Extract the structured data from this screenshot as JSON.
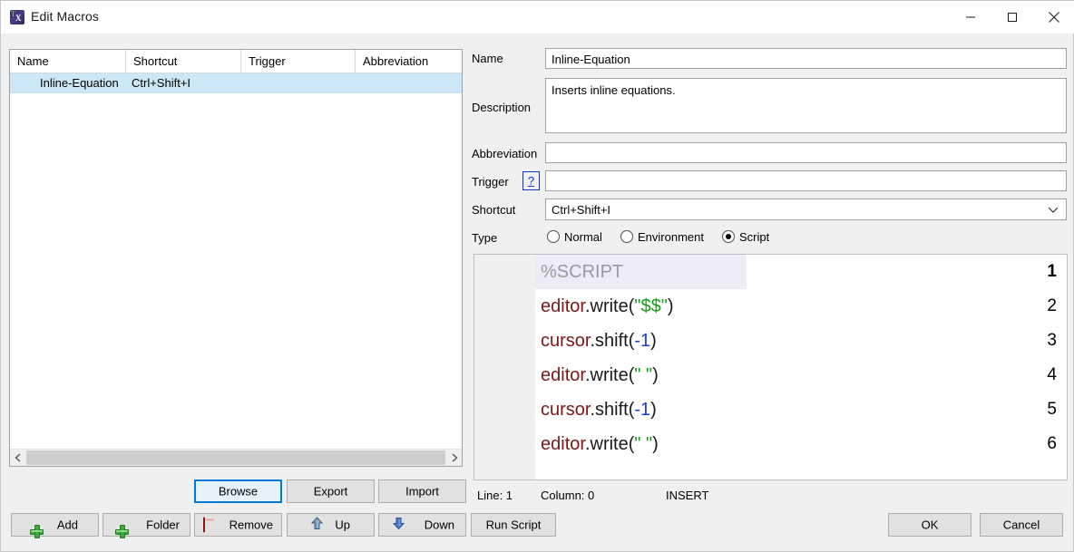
{
  "window": {
    "title": "Edit Macros",
    "icon": "texstudio-macro-icon",
    "controls": {
      "minimize": "minimize-icon",
      "maximize": "maximize-icon",
      "close": "close-icon"
    }
  },
  "macro_list": {
    "columns": [
      "Name",
      "Shortcut",
      "Trigger",
      "Abbreviation"
    ],
    "rows": [
      {
        "name": "Inline-Equation",
        "shortcut": "Ctrl+Shift+I",
        "trigger": "",
        "abbreviation": "",
        "selected": true
      }
    ],
    "scrollbar": {
      "left_arrow": "chevron-left-icon",
      "right_arrow": "chevron-right-icon"
    }
  },
  "form": {
    "name_label": "Name",
    "name_value": "Inline-Equation",
    "description_label": "Description",
    "description_value": "Inserts inline equations.",
    "abbreviation_label": "Abbreviation",
    "abbreviation_value": "",
    "trigger_label": "Trigger",
    "trigger_value": "",
    "trigger_help": "?",
    "shortcut_label": "Shortcut",
    "shortcut_value": "Ctrl+Shift+I",
    "type_label": "Type",
    "type_options": [
      {
        "label": "Normal",
        "selected": false
      },
      {
        "label": "Environment",
        "selected": false
      },
      {
        "label": "Script",
        "selected": true
      }
    ]
  },
  "code_editor": {
    "current_line": 1,
    "lines": [
      {
        "n": "1",
        "tokens": [
          {
            "t": "%SCRIPT",
            "c": "c-com"
          }
        ]
      },
      {
        "n": "2",
        "tokens": [
          {
            "t": "editor",
            "c": "c-obj"
          },
          {
            "t": ".write(",
            "c": "c-def"
          },
          {
            "t": "\"$$\"",
            "c": "c-str"
          },
          {
            "t": ")",
            "c": "c-def"
          }
        ]
      },
      {
        "n": "3",
        "tokens": [
          {
            "t": "cursor",
            "c": "c-obj"
          },
          {
            "t": ".shift(",
            "c": "c-def"
          },
          {
            "t": "-1",
            "c": "c-num"
          },
          {
            "t": ")",
            "c": "c-def"
          }
        ]
      },
      {
        "n": "4",
        "tokens": [
          {
            "t": "editor",
            "c": "c-obj"
          },
          {
            "t": ".write(",
            "c": "c-def"
          },
          {
            "t": "\" \"",
            "c": "c-str"
          },
          {
            "t": ")",
            "c": "c-def"
          }
        ]
      },
      {
        "n": "5",
        "tokens": [
          {
            "t": "cursor",
            "c": "c-obj"
          },
          {
            "t": ".shift(",
            "c": "c-def"
          },
          {
            "t": "-1",
            "c": "c-num"
          },
          {
            "t": ")",
            "c": "c-def"
          }
        ]
      },
      {
        "n": "6",
        "tokens": [
          {
            "t": "editor",
            "c": "c-obj"
          },
          {
            "t": ".write(",
            "c": "c-def"
          },
          {
            "t": "\" \"",
            "c": "c-str"
          },
          {
            "t": ")",
            "c": "c-def"
          }
        ]
      }
    ]
  },
  "status": {
    "line": "Line: 1",
    "column": "Column: 0",
    "mode": "INSERT"
  },
  "buttons": {
    "browse": "Browse",
    "export": "Export",
    "import": "Import",
    "add": "Add",
    "folder": "Folder",
    "remove": "Remove",
    "up": "Up",
    "down": "Down",
    "run_script": "Run Script",
    "ok": "OK",
    "cancel": "Cancel"
  },
  "colors": {
    "selection": "#cce8f6",
    "focus": "#0078d7",
    "code_highlight": "#ececf8",
    "string": "#179c17",
    "object": "#7b1717",
    "number": "#1a3fd0",
    "comment": "#9a9a9a"
  }
}
